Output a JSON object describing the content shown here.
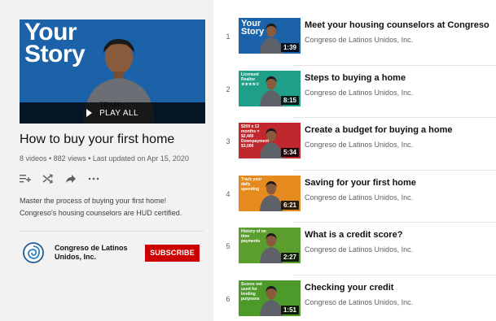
{
  "playlist": {
    "hero_text": "Your Story",
    "play_all": "PLAY ALL",
    "title": "How to buy your first home",
    "stats": "8 videos • 882 views • Last updated on Apr 15, 2020",
    "description": "Master the process of buying your first home! Congreso's housing counselors are HUD certified.",
    "owner_name": "Congreso de Latinos Unidos, Inc.",
    "subscribe_label": "SUBSCRIBE",
    "accent_color": "#cc0000"
  },
  "videos": [
    {
      "index": "1",
      "title": "Meet your housing counselors at Congreso",
      "channel": "Congreso de Latinos Unidos, Inc.",
      "duration": "1:39",
      "thumb_caption": "Your Story",
      "thumb_color": "#1b62a8"
    },
    {
      "index": "2",
      "title": "Steps to buying a home",
      "channel": "Congreso de Latinos Unidos, Inc.",
      "duration": "8:15",
      "thumb_caption": "Licensed Realtor ★★★★☆",
      "thumb_color": "#1f9f87"
    },
    {
      "index": "3",
      "title": "Create a budget for buying a home",
      "channel": "Congreso de Latinos Unidos, Inc.",
      "duration": "5:34",
      "thumb_caption": "$200 x 12 months = $2,400 Downpayment $3,000",
      "thumb_color": "#c0282e"
    },
    {
      "index": "4",
      "title": "Saving for your first home",
      "channel": "Congreso de Latinos Unidos, Inc.",
      "duration": "6:21",
      "thumb_caption": "Track your daily spending",
      "thumb_color": "#e58a1f"
    },
    {
      "index": "5",
      "title": "What is a credit score?",
      "channel": "Congreso de Latinos Unidos, Inc.",
      "duration": "2:27",
      "thumb_caption": "History of on time payments",
      "thumb_color": "#5c9e2e"
    },
    {
      "index": "6",
      "title": "Checking your credit",
      "channel": "Congreso de Latinos Unidos, Inc.",
      "duration": "1:51",
      "thumb_caption": "Scores not used for lending purposes",
      "thumb_color": "#4d9a2a"
    }
  ]
}
